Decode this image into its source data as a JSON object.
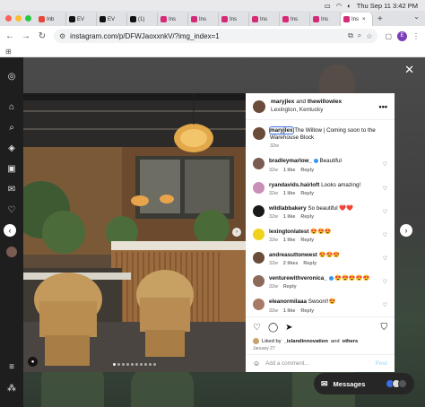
{
  "menubar": {
    "datetime": "Thu Sep 11  3:42 PM"
  },
  "browser": {
    "tabs": [
      {
        "label": "Inb",
        "color": "#e8463a"
      },
      {
        "label": "EV",
        "color": "#111111"
      },
      {
        "label": "EV",
        "color": "#111111"
      },
      {
        "label": "(1)",
        "color": "#111111"
      },
      {
        "label": "Ins",
        "color": "#d62976"
      },
      {
        "label": "Ins",
        "color": "#d62976"
      },
      {
        "label": "Ins",
        "color": "#d62976"
      },
      {
        "label": "Ins",
        "color": "#d62976"
      },
      {
        "label": "Ins",
        "color": "#d62976"
      },
      {
        "label": "Ins",
        "color": "#d62976"
      },
      {
        "label": "Ins",
        "color": "#d62976"
      }
    ],
    "active_tab_close": "×",
    "new_tab": "+",
    "url": "instagram.com/p/DFWJaoxxnkV/?img_index=1",
    "profile_initial": "E"
  },
  "post": {
    "author": "maryjlex",
    "coauthor_joiner": "and",
    "coauthor": "thewillowlex",
    "location": "Lexington, Kentucky",
    "more": "•••",
    "caption_user": "maryjlex",
    "caption_text": " The Willow | Coming soon to the Warehouse Block",
    "caption_time": "32w",
    "comments": [
      {
        "user": "bradleymarlow_",
        "verified": true,
        "text": " Beautiful",
        "time": "32w",
        "likes": "1 like",
        "reply": "Reply",
        "avatar": "#7a5b52"
      },
      {
        "user": "ryandavids.hairloft",
        "verified": false,
        "text": " Looks amazing!",
        "time": "32w",
        "likes": "1 like",
        "reply": "Reply",
        "avatar": "#c98fb6"
      },
      {
        "user": "wildlabbakery",
        "verified": false,
        "text": " So beautiful ❤️❤️",
        "time": "32w",
        "likes": "1 like",
        "reply": "Reply",
        "avatar": "#1a1a1a"
      },
      {
        "user": "lexingtonlatest",
        "verified": false,
        "text": " 😍😍😍",
        "time": "32w",
        "likes": "1 like",
        "reply": "Reply",
        "avatar": "#f0d21c"
      },
      {
        "user": "andreasuttonwest",
        "verified": false,
        "text": " 😍😍😍",
        "time": "32w",
        "likes": "2 likes",
        "reply": "Reply",
        "avatar": "#6b4b3a"
      },
      {
        "user": "venturewithveronica_",
        "verified": true,
        "text": " 😍😍😍😍😍",
        "time": "32w",
        "likes": "",
        "reply": "Reply",
        "avatar": "#8c6a5a"
      },
      {
        "user": "eleanormilaaa",
        "verified": false,
        "text": " Swoon!!😍",
        "time": "32w",
        "likes": "1 like",
        "reply": "Reply",
        "avatar": "#a87a66"
      }
    ],
    "liked_by_prefix": "Liked by",
    "liked_by_user": "_islandinnovation",
    "liked_by_and": "and",
    "liked_by_others": "others",
    "date": "January 27",
    "add_comment_placeholder": "Add a comment...",
    "post_button": "Post"
  },
  "messages": {
    "label": "Messages"
  },
  "carousel": {
    "count": 10,
    "active": 0
  }
}
